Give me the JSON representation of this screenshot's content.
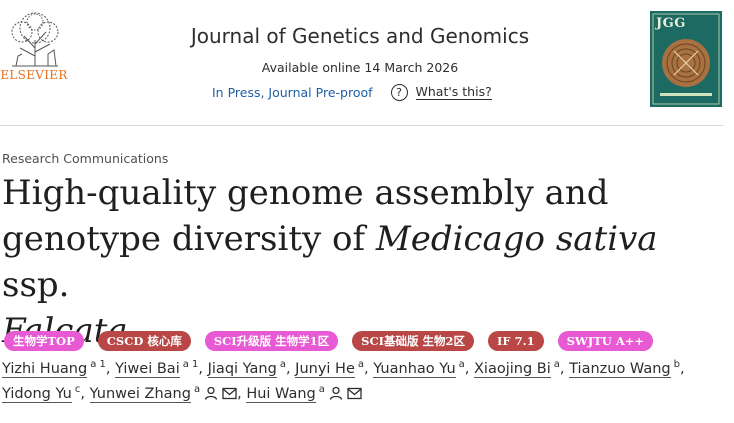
{
  "publisher": {
    "logo_text": "ELSEVIER"
  },
  "journal": {
    "title": "Journal of Genetics and Genomics",
    "available": "Available online 14 March 2026",
    "status": "In Press, Journal Pre-proof",
    "help_link": "What's this?",
    "help_icon": "question-circle-icon",
    "cover_label": "JGG"
  },
  "article": {
    "type": "Research Communications",
    "title_line1": "High-quality genome assembly and",
    "title_line2_a": "genotype diversity of ",
    "title_line2_italic": "Medicago sativa",
    "title_line2_b": " ssp.",
    "title_line3_italic": "Falcata"
  },
  "badges": [
    {
      "label": "生物学TOP",
      "color": "#e85ad3"
    },
    {
      "label": "CSCD 核心库",
      "color": "#b84745"
    },
    {
      "label": "SCI升级版 生物学1区",
      "color": "#e85ad3"
    },
    {
      "label": "SCI基础版 生物2区",
      "color": "#b84745"
    },
    {
      "label": "IF 7.1",
      "color": "#b84745"
    },
    {
      "label": "SWJTU A++",
      "color": "#e85ad3"
    }
  ],
  "authors": [
    {
      "name": "Yizhi Huang",
      "sup": "a 1"
    },
    {
      "name": "Yiwei Bai",
      "sup": "a 1"
    },
    {
      "name": "Jiaqi Yang",
      "sup": "a"
    },
    {
      "name": "Junyi He",
      "sup": "a"
    },
    {
      "name": "Yuanhao Yu",
      "sup": "a"
    },
    {
      "name": "Xiaojing Bi",
      "sup": "a"
    },
    {
      "name": "Tianzuo Wang",
      "sup": "b"
    },
    {
      "name": "Yidong Yu",
      "sup": "c"
    },
    {
      "name": "Yunwei Zhang",
      "sup": "a",
      "icons": [
        "person-icon",
        "envelope-icon"
      ]
    },
    {
      "name": "Hui Wang",
      "sup": "a",
      "icons": [
        "person-icon",
        "envelope-icon"
      ]
    }
  ],
  "separator": ", "
}
